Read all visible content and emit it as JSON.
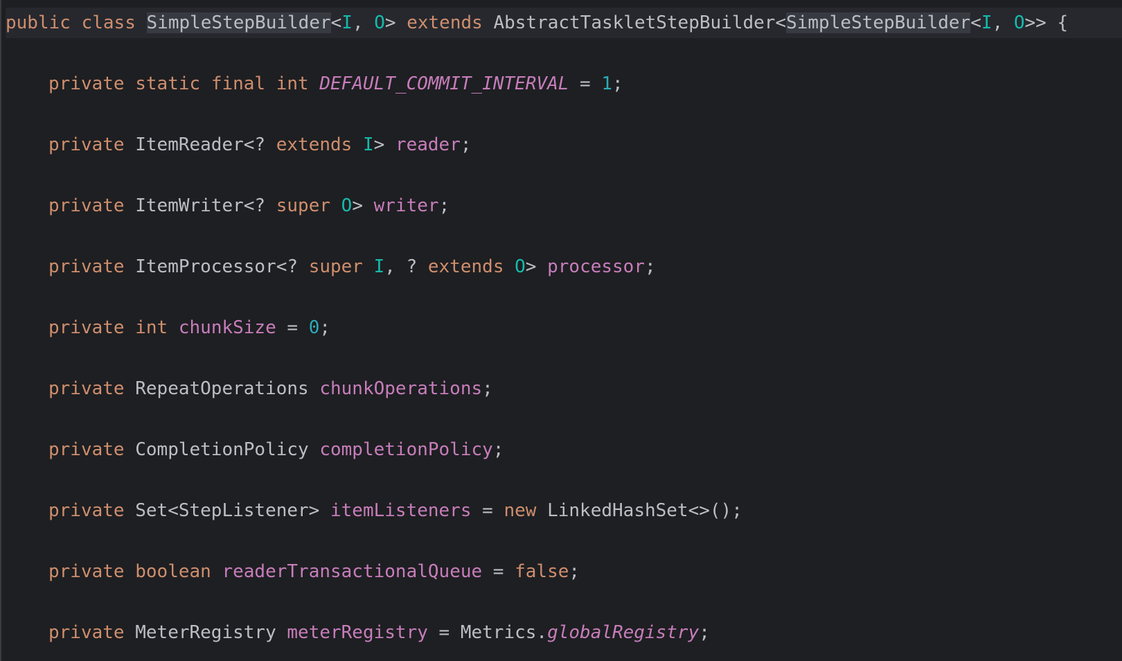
{
  "editor": {
    "lines": [
      {
        "tokens": [
          {
            "t": "public",
            "c": "kw"
          },
          {
            "t": " ",
            "c": "plain"
          },
          {
            "t": "class",
            "c": "kw"
          },
          {
            "t": " ",
            "c": "plain"
          },
          {
            "t": "SimpleStepBuilder",
            "c": "plain hl"
          },
          {
            "t": "<",
            "c": "plain"
          },
          {
            "t": "I",
            "c": "tp"
          },
          {
            "t": ", ",
            "c": "plain"
          },
          {
            "t": "O",
            "c": "tp"
          },
          {
            "t": "> ",
            "c": "plain"
          },
          {
            "t": "extends",
            "c": "kw"
          },
          {
            "t": " AbstractTaskletStepBuilder<",
            "c": "plain"
          },
          {
            "t": "SimpleStepBuilder",
            "c": "plain hl"
          },
          {
            "t": "<",
            "c": "plain"
          },
          {
            "t": "I",
            "c": "tp"
          },
          {
            "t": ", ",
            "c": "plain"
          },
          {
            "t": "O",
            "c": "tp"
          },
          {
            "t": ">> {",
            "c": "plain"
          }
        ]
      },
      {
        "tokens": [
          {
            "t": "private",
            "c": "kw"
          },
          {
            "t": " ",
            "c": "plain"
          },
          {
            "t": "static",
            "c": "kw"
          },
          {
            "t": " ",
            "c": "plain"
          },
          {
            "t": "final",
            "c": "kw"
          },
          {
            "t": " ",
            "c": "plain"
          },
          {
            "t": "int",
            "c": "kw"
          },
          {
            "t": " ",
            "c": "plain"
          },
          {
            "t": "DEFAULT_COMMIT_INTERVAL",
            "c": "const"
          },
          {
            "t": " = ",
            "c": "plain"
          },
          {
            "t": "1",
            "c": "num"
          },
          {
            "t": ";",
            "c": "plain"
          }
        ]
      },
      {
        "tokens": [
          {
            "t": "private",
            "c": "kw"
          },
          {
            "t": " ItemReader<? ",
            "c": "plain"
          },
          {
            "t": "extends",
            "c": "kw"
          },
          {
            "t": " ",
            "c": "plain"
          },
          {
            "t": "I",
            "c": "tp"
          },
          {
            "t": "> ",
            "c": "plain"
          },
          {
            "t": "reader",
            "c": "fld"
          },
          {
            "t": ";",
            "c": "plain"
          }
        ]
      },
      {
        "tokens": [
          {
            "t": "private",
            "c": "kw"
          },
          {
            "t": " ItemWriter<? ",
            "c": "plain"
          },
          {
            "t": "super",
            "c": "kw"
          },
          {
            "t": " ",
            "c": "plain"
          },
          {
            "t": "O",
            "c": "tp"
          },
          {
            "t": "> ",
            "c": "plain"
          },
          {
            "t": "writer",
            "c": "fld"
          },
          {
            "t": ";",
            "c": "plain"
          }
        ]
      },
      {
        "tokens": [
          {
            "t": "private",
            "c": "kw"
          },
          {
            "t": " ItemProcessor<? ",
            "c": "plain"
          },
          {
            "t": "super",
            "c": "kw"
          },
          {
            "t": " ",
            "c": "plain"
          },
          {
            "t": "I",
            "c": "tp"
          },
          {
            "t": ", ? ",
            "c": "plain"
          },
          {
            "t": "extends",
            "c": "kw"
          },
          {
            "t": " ",
            "c": "plain"
          },
          {
            "t": "O",
            "c": "tp"
          },
          {
            "t": "> ",
            "c": "plain"
          },
          {
            "t": "processor",
            "c": "fld"
          },
          {
            "t": ";",
            "c": "plain"
          }
        ]
      },
      {
        "tokens": [
          {
            "t": "private",
            "c": "kw"
          },
          {
            "t": " ",
            "c": "plain"
          },
          {
            "t": "int",
            "c": "kw"
          },
          {
            "t": " ",
            "c": "plain"
          },
          {
            "t": "chunkSize",
            "c": "fld"
          },
          {
            "t": " = ",
            "c": "plain"
          },
          {
            "t": "0",
            "c": "num"
          },
          {
            "t": ";",
            "c": "plain"
          }
        ]
      },
      {
        "tokens": [
          {
            "t": "private",
            "c": "kw"
          },
          {
            "t": " RepeatOperations ",
            "c": "plain"
          },
          {
            "t": "chunkOperations",
            "c": "fld"
          },
          {
            "t": ";",
            "c": "plain"
          }
        ]
      },
      {
        "tokens": [
          {
            "t": "private",
            "c": "kw"
          },
          {
            "t": " CompletionPolicy ",
            "c": "plain"
          },
          {
            "t": "completionPolicy",
            "c": "fld"
          },
          {
            "t": ";",
            "c": "plain"
          }
        ]
      },
      {
        "tokens": [
          {
            "t": "private",
            "c": "kw"
          },
          {
            "t": " Set<StepListener> ",
            "c": "plain"
          },
          {
            "t": "itemListeners",
            "c": "fld"
          },
          {
            "t": " = ",
            "c": "plain"
          },
          {
            "t": "new",
            "c": "kw"
          },
          {
            "t": " LinkedHashSet<>();",
            "c": "plain"
          }
        ]
      },
      {
        "tokens": [
          {
            "t": "private",
            "c": "kw"
          },
          {
            "t": " ",
            "c": "plain"
          },
          {
            "t": "boolean",
            "c": "kw"
          },
          {
            "t": " ",
            "c": "plain"
          },
          {
            "t": "readerTransactionalQueue",
            "c": "fld"
          },
          {
            "t": " = ",
            "c": "plain"
          },
          {
            "t": "false",
            "c": "kw"
          },
          {
            "t": ";",
            "c": "plain"
          }
        ]
      },
      {
        "tokens": [
          {
            "t": "private",
            "c": "kw"
          },
          {
            "t": " MeterRegistry ",
            "c": "plain"
          },
          {
            "t": "meterRegistry",
            "c": "fld"
          },
          {
            "t": " = Metrics.",
            "c": "plain"
          },
          {
            "t": "globalRegistry",
            "c": "const"
          },
          {
            "t": ";",
            "c": "plain"
          }
        ]
      }
    ]
  }
}
